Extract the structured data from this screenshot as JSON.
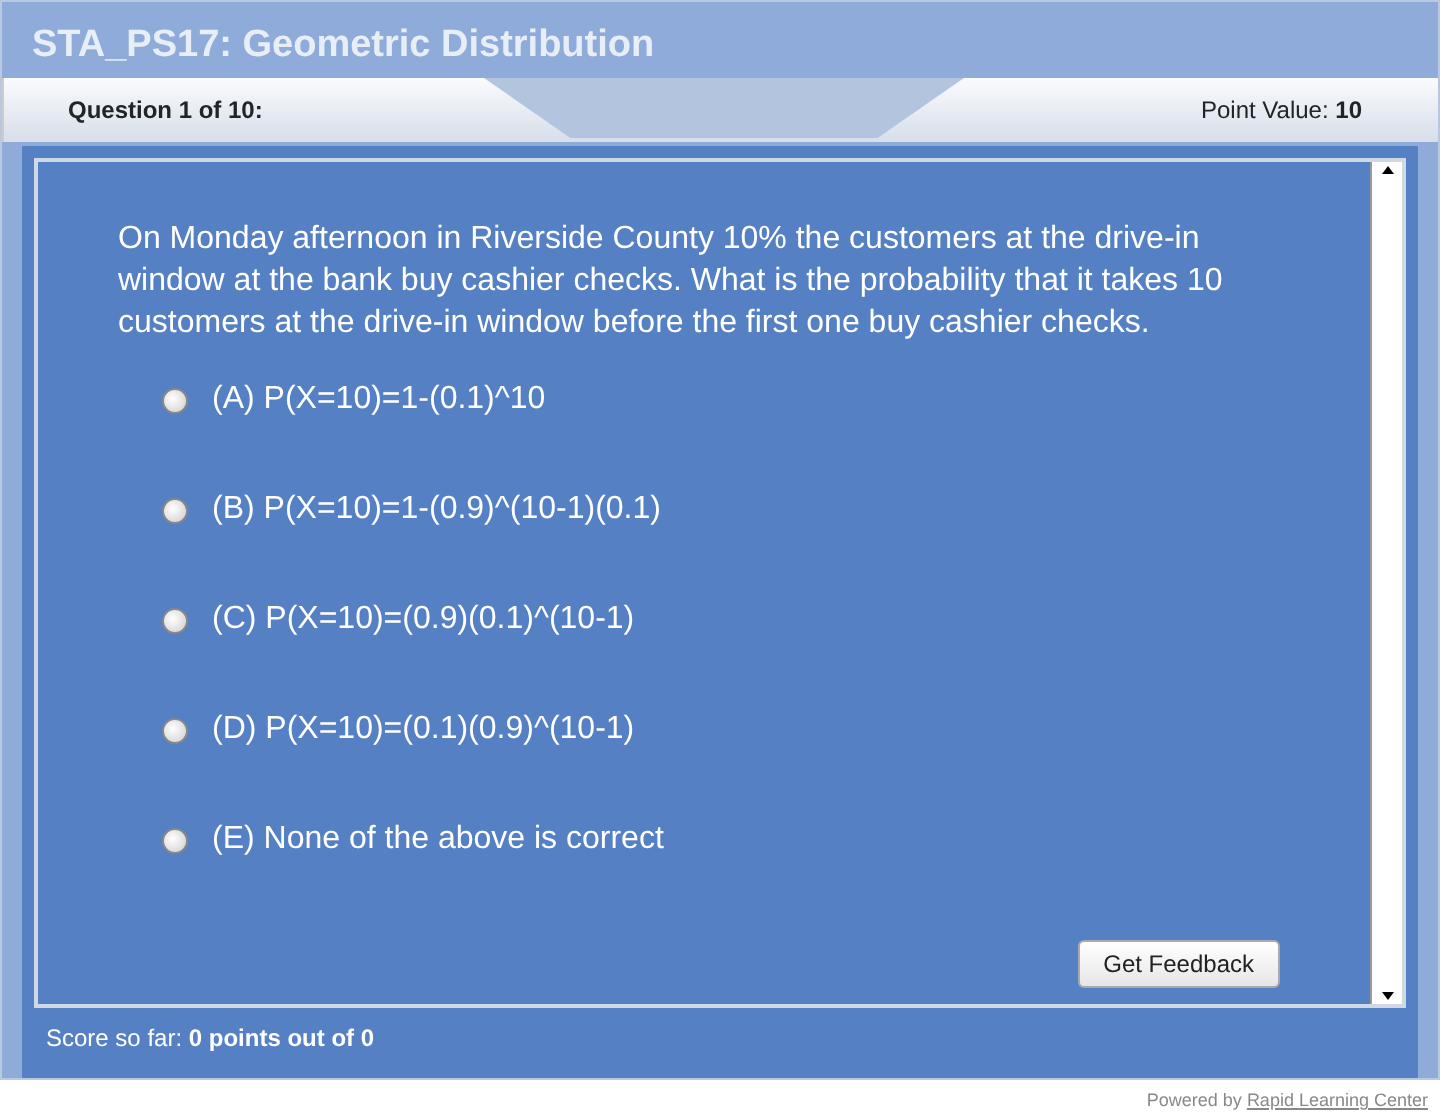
{
  "window": {
    "title": "STA_PS17: Geometric Distribution"
  },
  "header": {
    "question": "Question 1 of 10:",
    "point_label": "Point Value: ",
    "point_value": "10"
  },
  "question": "On Monday afternoon in Riverside County 10% the customers at the drive-in window at the bank buy cashier checks. What is the probability that it takes 10 customers at the drive-in window before the first one buy cashier checks.",
  "options": [
    {
      "label": "(A) P(X=10)=1-(0.1)^10",
      "selected": false
    },
    {
      "label": "(B) P(X=10)=1-(0.9)^(10-1)(0.1)",
      "selected": false
    },
    {
      "label": "(C) P(X=10)=(0.9)(0.1)^(10-1)",
      "selected": false
    },
    {
      "label": "(D) P(X=10)=(0.1)(0.9)^(10-1)",
      "selected": false
    },
    {
      "label": "(E) None of the above is correct",
      "selected": false
    }
  ],
  "button": "Get Feedback",
  "score": {
    "label": "Score so far: ",
    "value": "0 points out of 0"
  },
  "footer": {
    "label": "Powered by ",
    "link": "Rapid Learning Center"
  }
}
